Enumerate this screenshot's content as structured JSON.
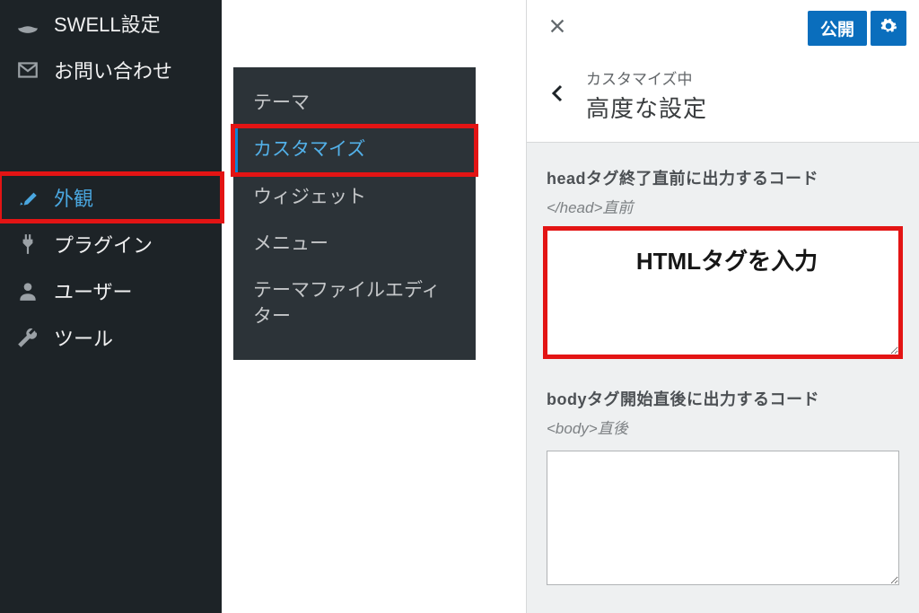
{
  "sidebar": {
    "items": [
      {
        "label": "SWELL設定",
        "icon": "swell-icon"
      },
      {
        "label": "お問い合わせ",
        "icon": "envelope-icon"
      },
      {
        "label": "外観",
        "icon": "paintbrush-icon",
        "active": true,
        "highlight": true
      },
      {
        "label": "プラグイン",
        "icon": "plug-icon"
      },
      {
        "label": "ユーザー",
        "icon": "user-icon"
      },
      {
        "label": "ツール",
        "icon": "wrench-icon"
      }
    ],
    "submenu": [
      {
        "label": "テーマ"
      },
      {
        "label": "カスタマイズ",
        "active": true,
        "highlight": true
      },
      {
        "label": "ウィジェット"
      },
      {
        "label": "メニュー"
      },
      {
        "label": "テーマファイルエディター"
      }
    ]
  },
  "panel": {
    "publish_label": "公開",
    "breadcrumb_small": "カスタマイズ中",
    "breadcrumb_big": "高度な設定",
    "fields": {
      "head": {
        "label": "headタグ終了直前に出力するコード",
        "hint": "</head>直前",
        "overlay": "HTMLタグを入力"
      },
      "body": {
        "label": "bodyタグ開始直後に出力するコード",
        "hint": "<body>直後"
      }
    }
  }
}
